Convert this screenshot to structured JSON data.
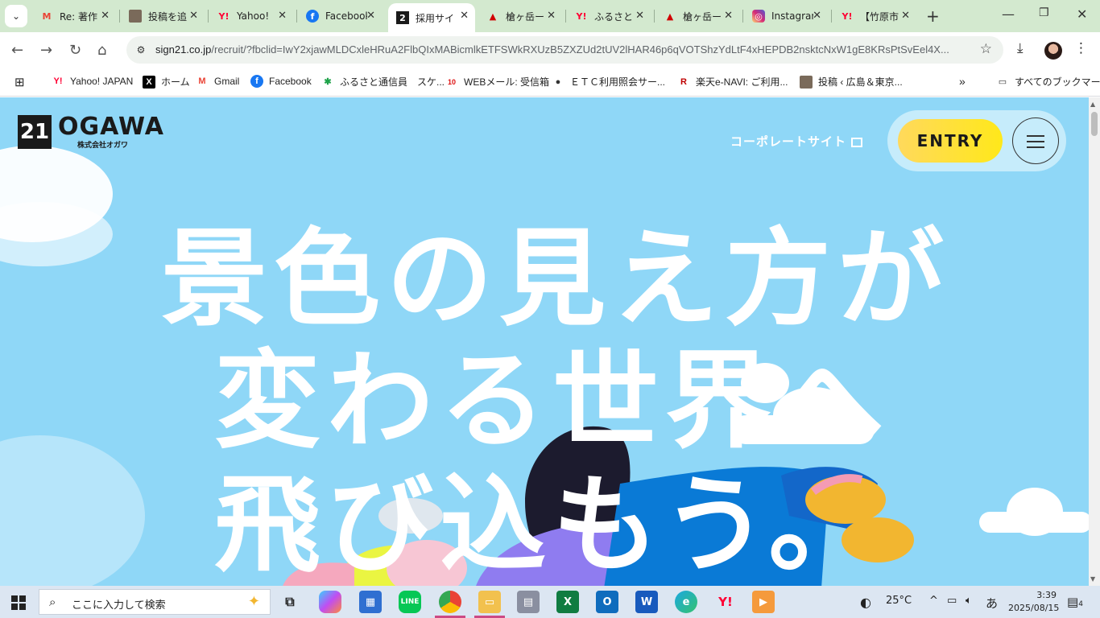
{
  "tabs": [
    {
      "title": "Re: 著作",
      "icon": "gmail-icon",
      "color": "#ea4335",
      "glyph": "M",
      "active": false
    },
    {
      "title": "投稿を追",
      "icon": "person-photo-icon",
      "color": "#5c4b3d",
      "glyph": "",
      "active": false
    },
    {
      "title": "Yahoo!",
      "icon": "yahoo-icon",
      "color": "#ff0033",
      "glyph": "Y!",
      "active": false
    },
    {
      "title": "Facebook",
      "icon": "facebook-icon",
      "color": "#1877f2",
      "glyph": "f",
      "active": false
    },
    {
      "title": "採用サイ",
      "icon": "ogawa-favicon-icon",
      "color": "#1a1a1a",
      "glyph": "2",
      "active": true
    },
    {
      "title": "槍ヶ岳ー",
      "icon": "mountain-icon",
      "color": "#d10000",
      "glyph": "▲",
      "active": false
    },
    {
      "title": "ふるさと",
      "icon": "yahoo-icon",
      "color": "#ff0033",
      "glyph": "Y!",
      "active": false
    },
    {
      "title": "槍ヶ岳ー",
      "icon": "mountain-icon",
      "color": "#d10000",
      "glyph": "▲",
      "active": false
    },
    {
      "title": "Instagram",
      "icon": "instagram-icon",
      "color": "#d62976",
      "glyph": "◎",
      "active": false
    },
    {
      "title": "【竹原市",
      "icon": "yahoo-icon",
      "color": "#ff0033",
      "glyph": "Y!",
      "active": false
    }
  ],
  "address": {
    "host": "sign21.co.jp",
    "path": "/recruit/?fbclid=IwY2xjawMLDCxleHRuA2FlbQIxMABicmlkETFSWkRXUzB5ZXZUd2tUV2lHAR46p6qVOTShzYdLtF4xHEPDB2nsktcNxW1gE8KRsPtSvEel4X..."
  },
  "bookmarks": [
    {
      "label": "Yahoo! JAPAN",
      "icon": "yahoo-icon",
      "color": "#ff0033",
      "glyph": "Y!"
    },
    {
      "label": "ホーム",
      "icon": "x-logo-icon",
      "color": "#000000",
      "glyph": "X"
    },
    {
      "label": "Gmail",
      "icon": "gmail-icon",
      "color": "#ea4335",
      "glyph": "M"
    },
    {
      "label": "Facebook",
      "icon": "facebook-icon",
      "color": "#1877f2",
      "glyph": "f"
    },
    {
      "label": "ふるさと通信員　スケ...",
      "icon": "leaf-icon",
      "color": "#1fa34a",
      "glyph": "✱"
    },
    {
      "label": "WEBメール: 受信箱",
      "icon": "webmail-icon",
      "color": "#d11",
      "glyph": "10"
    },
    {
      "label": "ＥＴＣ利用照会サー...",
      "icon": "globe-icon",
      "color": "#333333",
      "glyph": "●"
    },
    {
      "label": "楽天e-NAVI: ご利用...",
      "icon": "rakuten-icon",
      "color": "#bf0000",
      "glyph": "R"
    },
    {
      "label": "投稿 ‹ 広島＆東京...",
      "icon": "person-photo-icon",
      "color": "#5c4b3d",
      "glyph": ""
    }
  ],
  "bookmarks_all": "すべてのブックマーク",
  "page": {
    "logo_word": "OGAWA",
    "logo_mark": "21",
    "logo_sub": "株式会社オガワ",
    "corporate_link": "コーポレートサイト",
    "entry": "ENTRY",
    "hero": [
      "景色の見え方が",
      "変わる世界へ",
      "飛び込もう。"
    ]
  },
  "taskbar": {
    "search_placeholder": "ここに入力して検索",
    "weather": "25°C",
    "ime": "あ",
    "time": "3:39",
    "date": "2025/08/15",
    "notifications": "4"
  },
  "colors": {
    "sky": "#8fd7f7",
    "entry_yellow": "#ffe81a",
    "tab_strip": "#d3e9cf"
  }
}
